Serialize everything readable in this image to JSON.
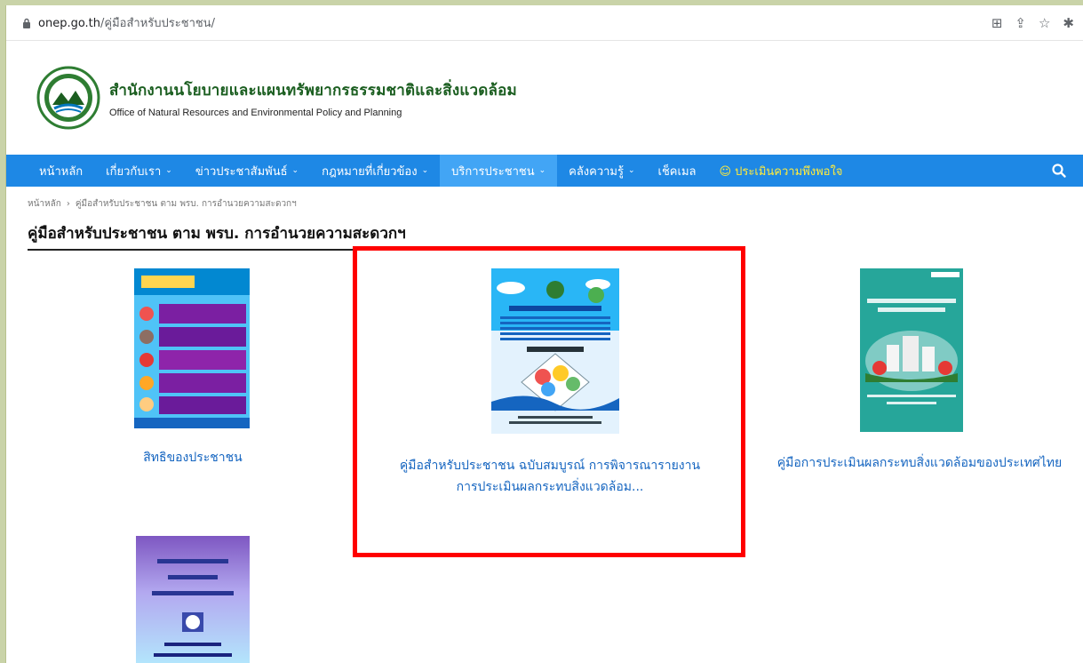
{
  "browser": {
    "url_host": "onep.go.th",
    "url_path": "/คู่มือสำหรับประชาชน/"
  },
  "site": {
    "name_th": "สำนักงานนโยบายและแผนทรัพยากรธรรมชาติและสิ่งแวดล้อม",
    "name_en": "Office of Natural Resources and Environmental Policy and Planning"
  },
  "nav": {
    "items": [
      {
        "label": "หน้าหลัก"
      },
      {
        "label": "เกี่ยวกับเรา"
      },
      {
        "label": "ข่าวประชาสัมพันธ์"
      },
      {
        "label": "กฎหมายที่เกี่ยวข้อง"
      },
      {
        "label": "บริการประชาชน"
      },
      {
        "label": "คลังความรู้"
      },
      {
        "label": "เช็คเมล"
      },
      {
        "label": "☺ ประเมินความพึงพอใจ"
      }
    ]
  },
  "breadcrumb": {
    "home": "หน้าหลัก",
    "sep": "›",
    "current": "คู่มือสำหรับประชาชน ตาม พรบ. การอำนวยความสะดวกฯ"
  },
  "page": {
    "title": "คู่มือสำหรับประชาชน ตาม พรบ. การอำนวยความสะดวกฯ"
  },
  "cards": [
    {
      "label": "สิทธิของประชาชน"
    },
    {
      "label_line1": "คู่มือสำหรับประชาชน ฉบับสมบูรณ์ การพิจารณารายงาน",
      "label_line2": "การประเมินผลกระทบสิ่งแวดล้อม..."
    },
    {
      "label": "คู่มือการประเมินผลกระทบสิ่งแวดล้อมของประเทศไทย"
    }
  ],
  "colors": {
    "nav_bg": "#1e88e5",
    "nav_active": "#42a5f5",
    "link": "#1565c0",
    "highlight": "#ff0000",
    "org_green": "#1b5e20"
  }
}
